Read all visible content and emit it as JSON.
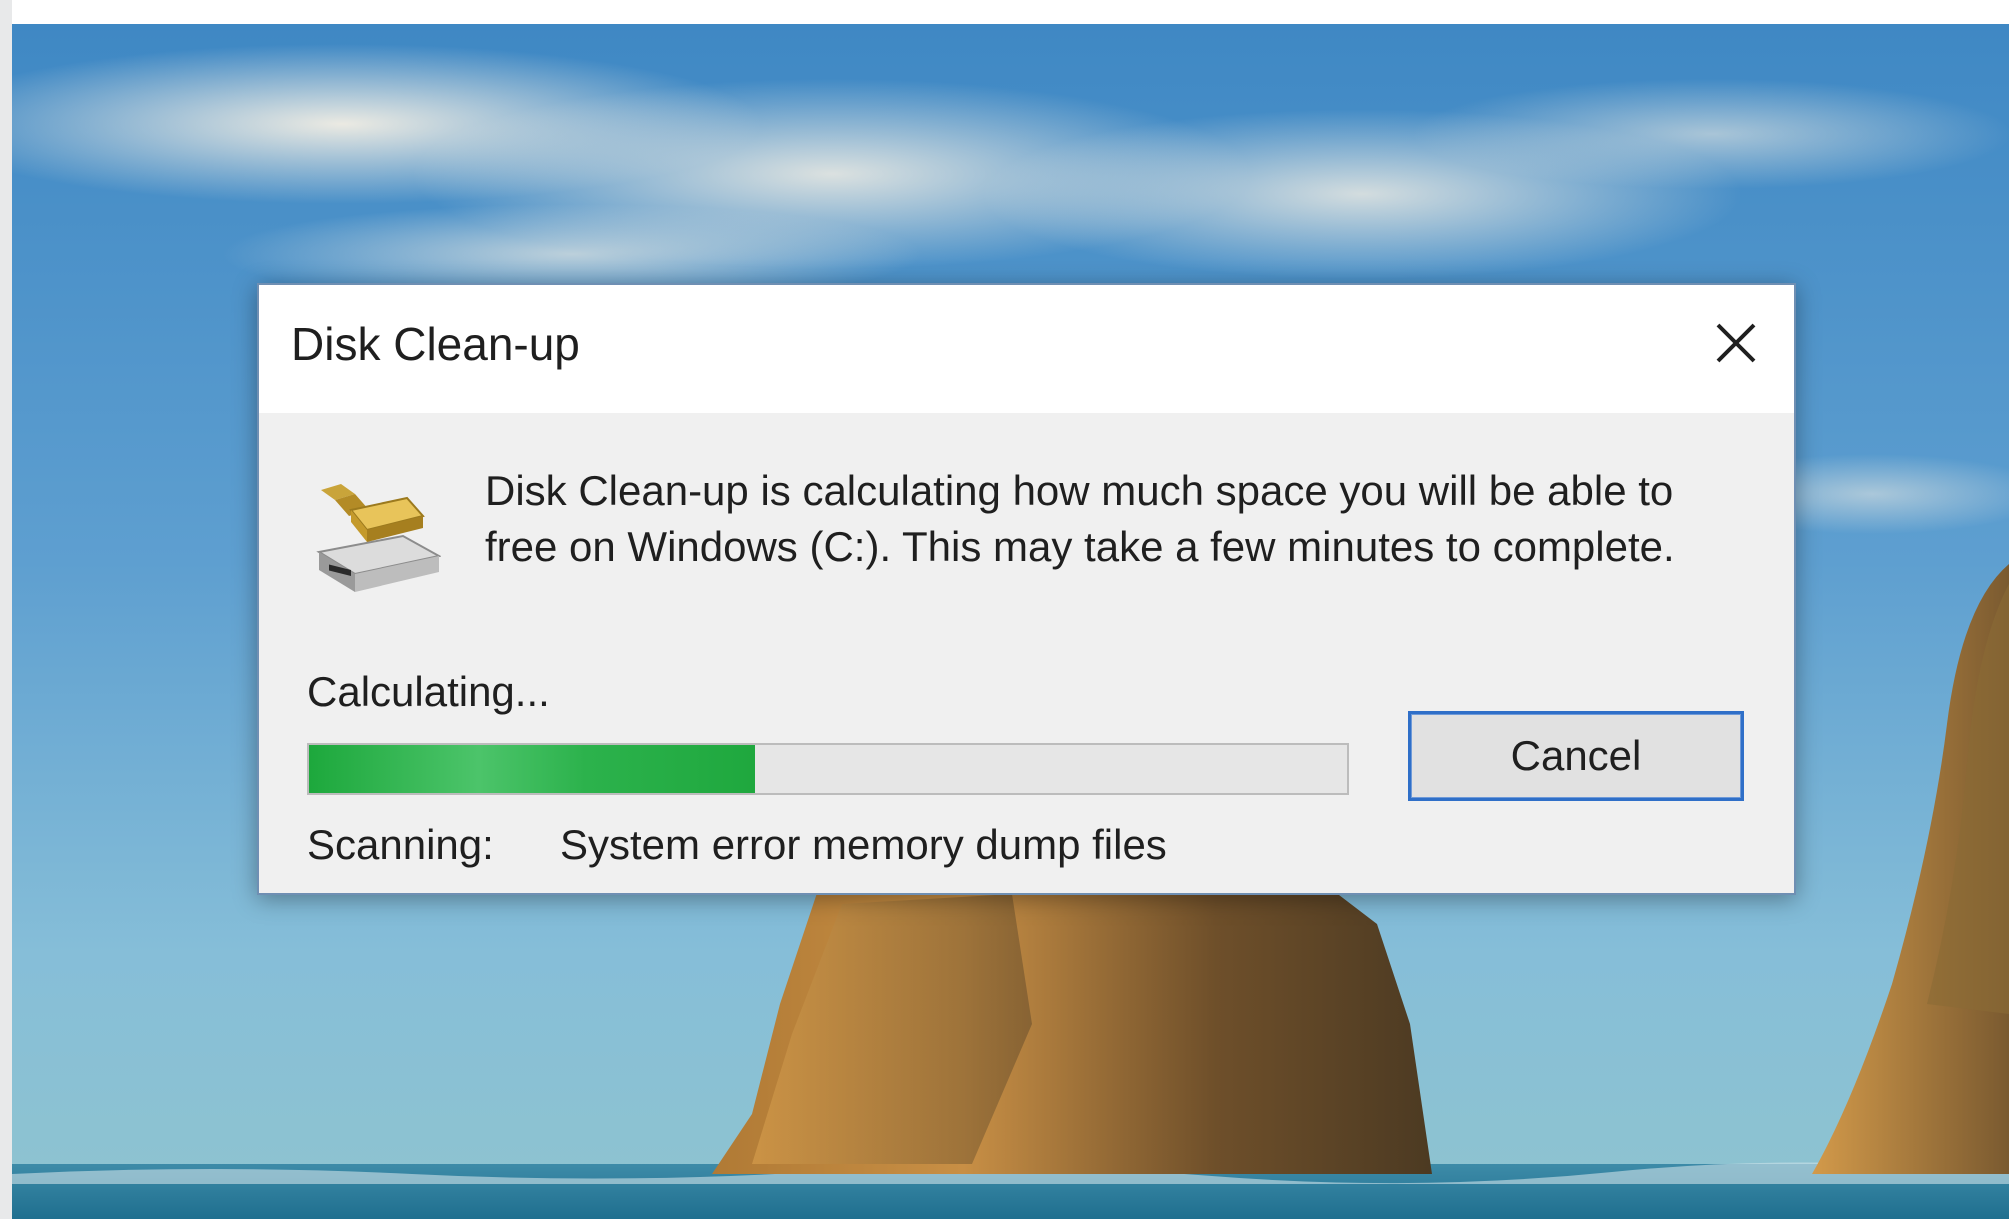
{
  "dialog": {
    "title": "Disk Clean-up",
    "close_icon": "close-icon",
    "app_icon": "disk-cleanup-icon",
    "message": "Disk Clean-up is calculating how much space you will be able to free on Windows (C:). This may take a few minutes to complete.",
    "status": "Calculating...",
    "progress_percent": 43,
    "scanning_label": "Scanning:",
    "scanning_item": "System error memory dump files",
    "cancel_label": "Cancel"
  },
  "colors": {
    "progress_fill": "#2cb24c",
    "button_focus_border": "#2f6fc8",
    "dialog_body": "#f0f0f0",
    "titlebar": "#ffffff"
  }
}
